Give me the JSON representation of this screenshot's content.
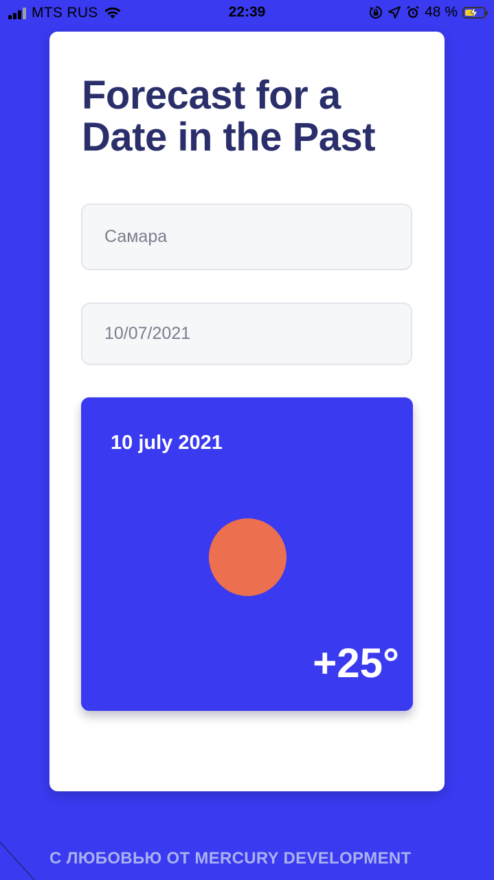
{
  "status_bar": {
    "carrier": "MTS RUS",
    "time": "22:39",
    "battery": "48 %",
    "battery_level": 0.48,
    "signal_bars_filled": 3,
    "icons": [
      "signal-icon",
      "wifi-icon",
      "rotation-lock-icon",
      "location-arrow-icon",
      "alarm-icon",
      "battery-charging-icon"
    ]
  },
  "page": {
    "title": "Forecast for a Date in the Past",
    "city_input": {
      "value": "Самара"
    },
    "date_input": {
      "value": "10/07/2021"
    }
  },
  "weather_card": {
    "date": "10 july 2021",
    "temperature": "+25°",
    "icon": "sun-icon"
  },
  "footer": {
    "text": "С ЛЮБОВЬЮ ОТ MERCURY DEVELOPMENT"
  },
  "colors": {
    "background": "#3a3af0",
    "card": "#ffffff",
    "title": "#2a2f6b",
    "sun": "#ec7050",
    "footer_text": "#a9b1f2"
  }
}
